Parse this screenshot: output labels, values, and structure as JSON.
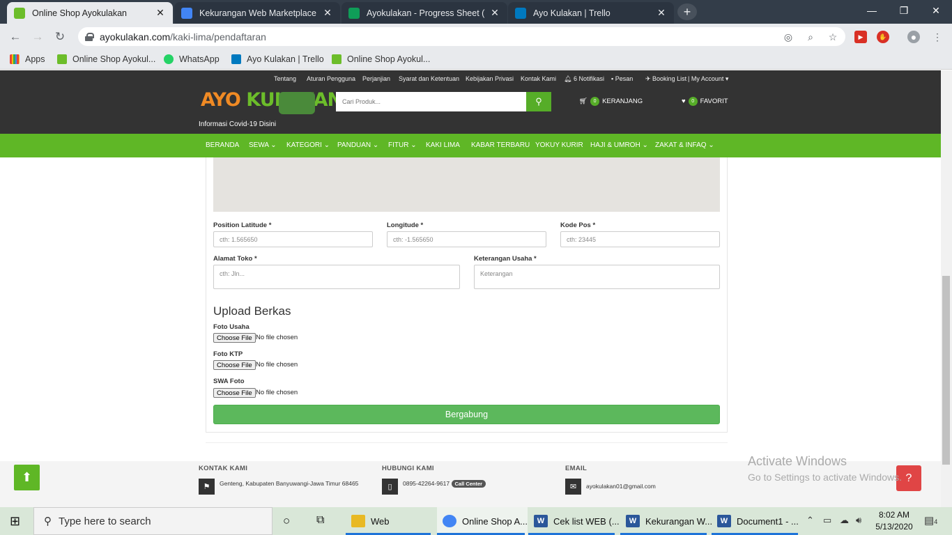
{
  "browser": {
    "tabs": [
      {
        "title": "Online Shop Ayokulakan",
        "icon": "ayokulakan-favicon",
        "color": "#6cbd2a"
      },
      {
        "title": "Kekurangan Web Marketplace Ay",
        "icon": "docs-icon",
        "color": "#4285f4"
      },
      {
        "title": "Ayokulakan - Progress Sheet (Yu",
        "icon": "sheets-icon",
        "color": "#0f9d58"
      },
      {
        "title": "Ayo Kulakan | Trello",
        "icon": "trello-icon",
        "color": "#0079bf"
      }
    ],
    "url_host": "ayokulakan.com",
    "url_path": "/kaki-lima/pendaftaran",
    "bookmarks": [
      "Apps",
      "Online Shop Ayokul...",
      "WhatsApp",
      "Ayo Kulakan | Trello",
      "Online Shop Ayokul..."
    ]
  },
  "site": {
    "top_links": [
      "Tentang",
      "Aturan Pengguna",
      "Perjanjian",
      "Syarat dan Ketentuan",
      "Kebijakan Privasi",
      "Kontak Kami",
      "6 Notifikasi",
      "Pesan",
      "Booking List",
      "| My Account"
    ],
    "logo_a": "AYO ",
    "logo_b": "KULAKAN",
    "covid": "Informasi Covid-19 Disini",
    "search_placeholder": "Cari Produk...",
    "cart_count": "0",
    "cart_label": "KERANJANG",
    "fav_count": "0",
    "fav_label": "FAVORIT",
    "menu": [
      "BERANDA",
      "SEWA",
      "KATEGORI",
      "PANDUAN",
      "FITUR",
      "KAKI LIMA",
      "KABAR TERBARU",
      "YOKUY KURIR",
      "HAJI & UMROH",
      "ZAKAT & INFAQ"
    ]
  },
  "form": {
    "latitude_label": "Position Latitude *",
    "latitude_placeholder": "cth: 1.565650",
    "longitude_label": "Longitude *",
    "longitude_placeholder": "cth: -1.565650",
    "kodepos_label": "Kode Pos *",
    "kodepos_placeholder": "cth: 23445",
    "alamat_label": "Alamat Toko *",
    "alamat_placeholder": "cth: Jln...",
    "keterangan_label": "Keterangan Usaha *",
    "keterangan_placeholder": "Keterangan",
    "upload_title": "Upload Berkas",
    "files": [
      {
        "label": "Foto Usaha",
        "button": "Choose File",
        "status": "No file chosen"
      },
      {
        "label": "Foto KTP",
        "button": "Choose File",
        "status": "No file chosen"
      },
      {
        "label": "SWA Foto",
        "button": "Choose File",
        "status": "No file chosen"
      }
    ],
    "submit": "Bergabung"
  },
  "footer": {
    "kontak_title": "KONTAK KAMI",
    "kontak_text": "Genteng, Kabupaten Banyuwangi-Jawa Timur 68465",
    "hubungi_title": "HUBUNGI KAMI",
    "hubungi_text": "0895-42264-9617",
    "call_center": "Call Center",
    "email_title": "EMAIL",
    "email_text": "ayokulakan01@gmail.com"
  },
  "activate": {
    "line1": "Activate Windows",
    "line2": "Go to Settings to activate Windows."
  },
  "taskbar": {
    "search_placeholder": "Type here to search",
    "items": [
      "Web",
      "Online Shop A...",
      "Cek list WEB (...",
      "Kekurangan W...",
      "Document1 - ..."
    ],
    "time": "8:02 AM",
    "date": "5/13/2020",
    "notif_count": "4"
  }
}
